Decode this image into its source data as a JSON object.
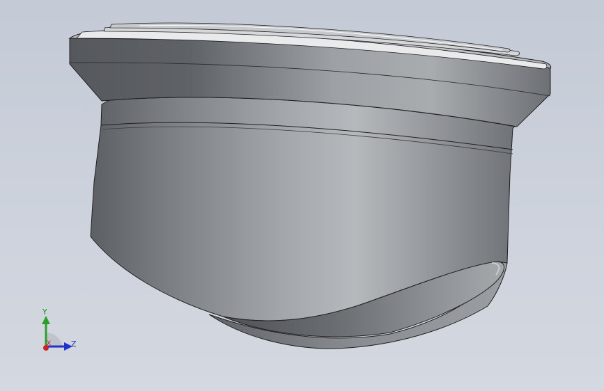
{
  "viewport": {
    "background_top": "#c4cad6",
    "background_bottom": "#d4d8e0"
  },
  "model": {
    "kind": "revolved-solid-part",
    "body_color": "#9ea1a5",
    "edge_color": "#202020",
    "highlight_color": "#eef0f2"
  },
  "triad": {
    "y_label": "Y",
    "z_label": "Z",
    "x_label": "X",
    "y_color": "#2aa02a",
    "z_color": "#2233cc",
    "x_color": "#d02020",
    "icon": "coordinate-triad-icon"
  }
}
